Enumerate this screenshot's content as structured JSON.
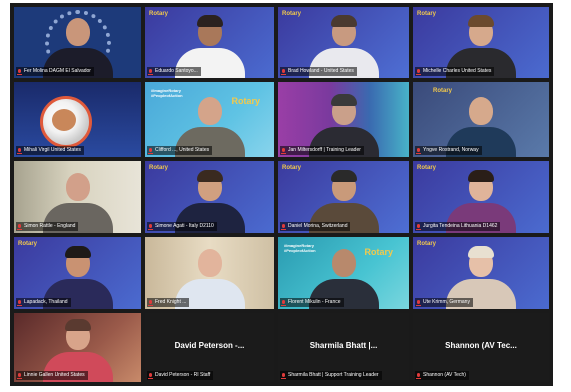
{
  "participants": [
    {
      "name": "Fer Molina DAGM El Salvador"
    },
    {
      "name": "Eduardo Santoyo..."
    },
    {
      "name": "Brad Howland - United States"
    },
    {
      "name": "Michelle Charles United States"
    },
    {
      "name": "Mihali Virgil United States"
    },
    {
      "name": "Clifford ..., United States"
    },
    {
      "name": "Jan Miltersdorff | Training Leader"
    },
    {
      "name": "Yngve Rostrand, Norway"
    },
    {
      "name": "Simon Rattle - England"
    },
    {
      "name": "Simone Agati - Italy D2110"
    },
    {
      "name": "Daniel Morina, Switzerland"
    },
    {
      "name": "Jurgita Tendeina Lithuania D1462"
    },
    {
      "name": "Lapadack, Thailand"
    },
    {
      "name": "Fred Knight ..."
    },
    {
      "name": "Florent Mikulin - France"
    },
    {
      "name": "Ute Krimm, Germany"
    },
    {
      "name": "Linnie Gallen United States"
    },
    {
      "name": "David Peterson - RI Staff",
      "display_name": "David Peterson -..."
    },
    {
      "name": "Sharmila Bhatt | Support Training Leader",
      "display_name": "Sharmila Bhatt |..."
    },
    {
      "name": "Shannon (AV Tech)",
      "display_name": "Shannon (AV Tec..."
    }
  ],
  "brand": {
    "rotary": "Rotary",
    "tagline": "#ImagineRotary #PeopleofAction"
  },
  "colors": {
    "speaker_highlight": "#d6e64a",
    "mic_muted": "#e03b3b",
    "rotary_blue": "#1f4fa3",
    "rotary_gold": "#f2c94c"
  },
  "icons": {
    "mic": "mic-muted-icon"
  }
}
